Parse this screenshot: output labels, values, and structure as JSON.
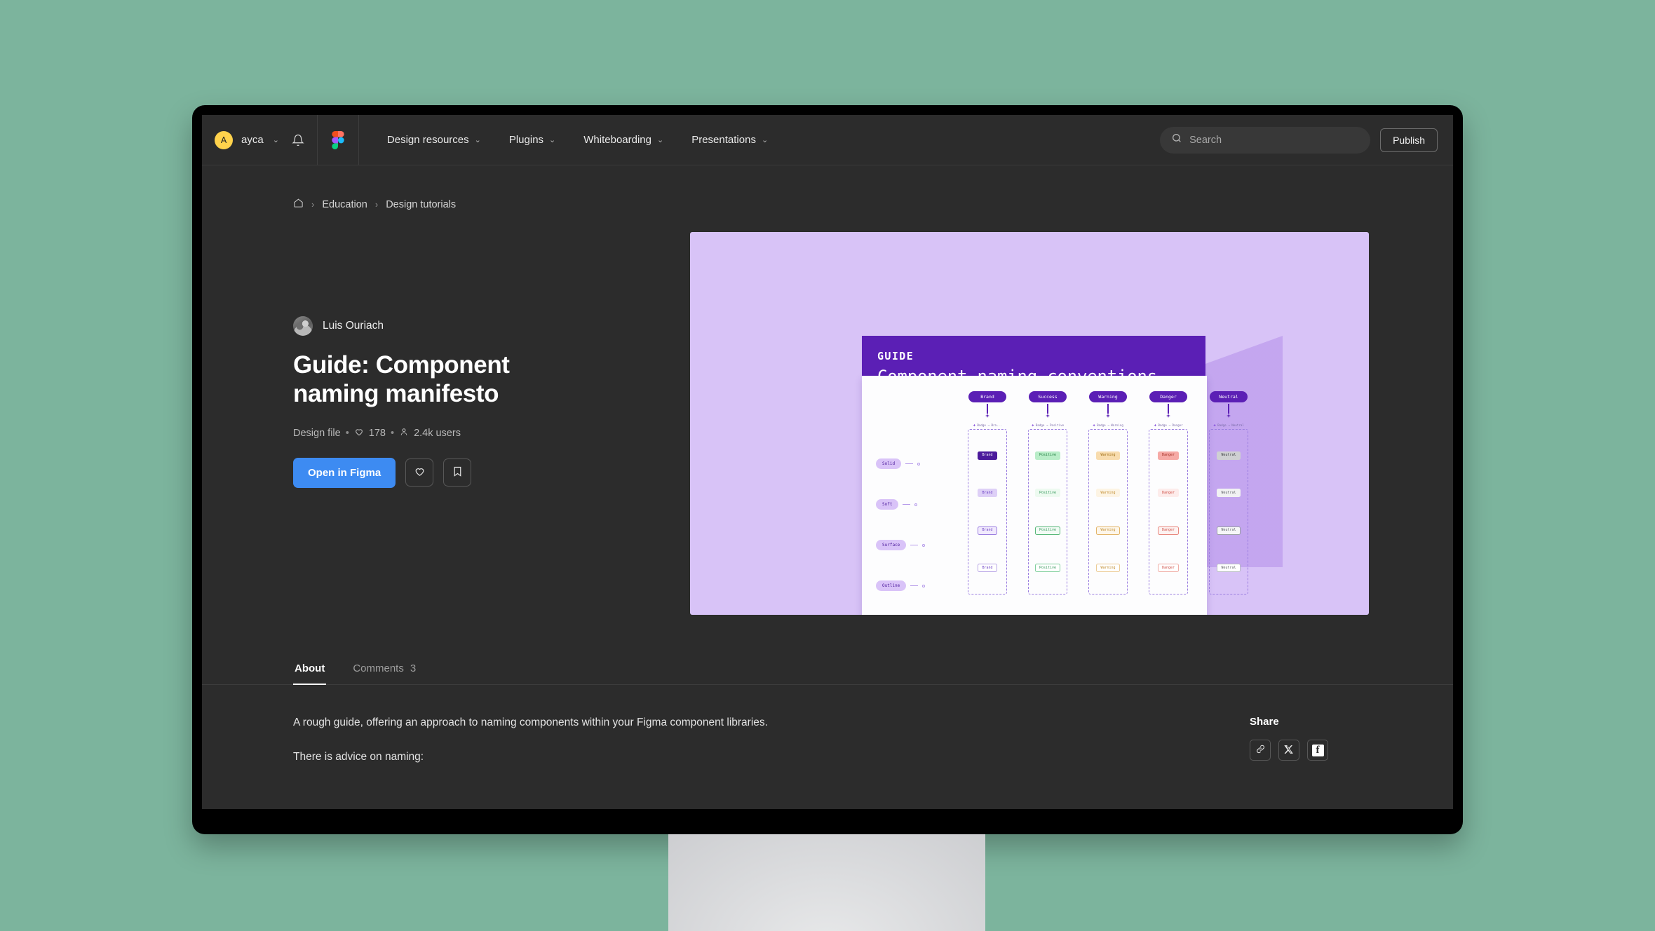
{
  "colors": {
    "page_background": "#7cb49d",
    "screen_background": "#2c2c2c",
    "accent_blue": "#3d8bf2",
    "avatar_yellow": "#ffd24c",
    "preview_lilac": "#d8c3f7",
    "poster_purple": "#5b1fb5"
  },
  "topnav": {
    "avatar_initial": "A",
    "team_name": "ayca",
    "team_chevron": "⌄",
    "bell_icon": "bell-icon",
    "figma_logo": "figma-logo-icon",
    "links": [
      {
        "label": "Design resources",
        "chevron": "⌄"
      },
      {
        "label": "Plugins",
        "chevron": "⌄"
      },
      {
        "label": "Whiteboarding",
        "chevron": "⌄"
      },
      {
        "label": "Presentations",
        "chevron": "⌄"
      }
    ],
    "search": {
      "icon": "search-icon",
      "placeholder": "Search",
      "value": ""
    },
    "publish_label": "Publish"
  },
  "breadcrumb": {
    "home_icon": "home-icon",
    "separator": "›",
    "items": [
      {
        "label": "Education"
      },
      {
        "label": "Design tutorials"
      }
    ]
  },
  "hero": {
    "author": {
      "name": "Luis Ouriach",
      "avatar": "author-avatar"
    },
    "title": "Guide: Component naming manifesto",
    "meta": {
      "kind": "Design file",
      "dot": "•",
      "heart_icon": "heart-icon",
      "likes": "178",
      "user_icon": "user-icon",
      "users": "2.4k users"
    },
    "actions": {
      "primary_label": "Open in Figma",
      "like_icon": "heart-icon",
      "save_icon": "bookmark-icon"
    }
  },
  "preview": {
    "poster": {
      "kicker": "GUIDE",
      "title": "Component naming conventions"
    },
    "diagram": {
      "row_labels": [
        "Solid",
        "Soft",
        "Surface",
        "Outline"
      ],
      "columns": [
        {
          "pill": "Brand",
          "group_label": "Badge → Bra...",
          "chips": [
            {
              "text": "Brand",
              "bg": "#4b1a9b",
              "fg": "#ffffff",
              "border": "transparent"
            },
            {
              "text": "Brand",
              "bg": "#ded0f7",
              "fg": "#6b3fc4",
              "border": "transparent"
            },
            {
              "text": "Brand",
              "bg": "#f1eafd",
              "fg": "#6b3fc4",
              "border": "#9b7ee0"
            },
            {
              "text": "Brand",
              "bg": "#ffffff",
              "fg": "#6b3fc4",
              "border": "#b9a6e6"
            }
          ]
        },
        {
          "pill": "Success",
          "group_label": "Badge → Positive",
          "chips": [
            {
              "text": "Positive",
              "bg": "#b9edc8",
              "fg": "#1d7a3e",
              "border": "transparent"
            },
            {
              "text": "Positive",
              "bg": "#edfaf0",
              "fg": "#2f9656",
              "border": "transparent"
            },
            {
              "text": "Positive",
              "bg": "#f2fbf5",
              "fg": "#2f9656",
              "border": "#58b87a"
            },
            {
              "text": "Positive",
              "bg": "#ffffff",
              "fg": "#2f9656",
              "border": "#7fcf9c"
            }
          ]
        },
        {
          "pill": "Warning",
          "group_label": "Badge → Warning",
          "chips": [
            {
              "text": "Warning",
              "bg": "#f8dcae",
              "fg": "#9c6b10",
              "border": "transparent"
            },
            {
              "text": "Warning",
              "bg": "#fdf4e4",
              "fg": "#c08a2a",
              "border": "transparent"
            },
            {
              "text": "Warning",
              "bg": "#fdf6ea",
              "fg": "#c08a2a",
              "border": "#e3b56a"
            },
            {
              "text": "Warning",
              "bg": "#ffffff",
              "fg": "#c08a2a",
              "border": "#eccb95"
            }
          ]
        },
        {
          "pill": "Danger",
          "group_label": "Badge → Danger",
          "chips": [
            {
              "text": "Danger",
              "bg": "#f6aaa6",
              "fg": "#a32b22",
              "border": "transparent"
            },
            {
              "text": "Danger",
              "bg": "#fdeceb",
              "fg": "#cf4f45",
              "border": "transparent"
            },
            {
              "text": "Danger",
              "bg": "#fdf2f1",
              "fg": "#cf4f45",
              "border": "#e8887f"
            },
            {
              "text": "Danger",
              "bg": "#ffffff",
              "fg": "#cf4f45",
              "border": "#f0ada6"
            }
          ]
        },
        {
          "pill": "Neutral",
          "group_label": "Badge → Neutral",
          "chips": [
            {
              "text": "Neutral",
              "bg": "#cfd0d2",
              "fg": "#3a3c40",
              "border": "transparent"
            },
            {
              "text": "Neutral",
              "bg": "#f1f2f3",
              "fg": "#5c5f64",
              "border": "transparent"
            },
            {
              "text": "Neutral",
              "bg": "#f6f7f8",
              "fg": "#5c5f64",
              "border": "#9aa0a6"
            },
            {
              "text": "Neutral",
              "bg": "#ffffff",
              "fg": "#5c5f64",
              "border": "#b7bcc1"
            }
          ]
        }
      ]
    }
  },
  "tabs": [
    {
      "label": "About",
      "count": "",
      "active": true
    },
    {
      "label": "Comments",
      "count": "3",
      "active": false
    }
  ],
  "about": {
    "paragraphs": [
      "A rough guide, offering an approach to naming components within your Figma component libraries.",
      "There is advice on naming:"
    ]
  },
  "share": {
    "title": "Share",
    "buttons": [
      {
        "icon": "link-icon",
        "name": "copy-link"
      },
      {
        "icon": "x-twitter-icon",
        "name": "share-x"
      },
      {
        "icon": "facebook-icon",
        "name": "share-facebook",
        "glyph": "f"
      }
    ]
  }
}
